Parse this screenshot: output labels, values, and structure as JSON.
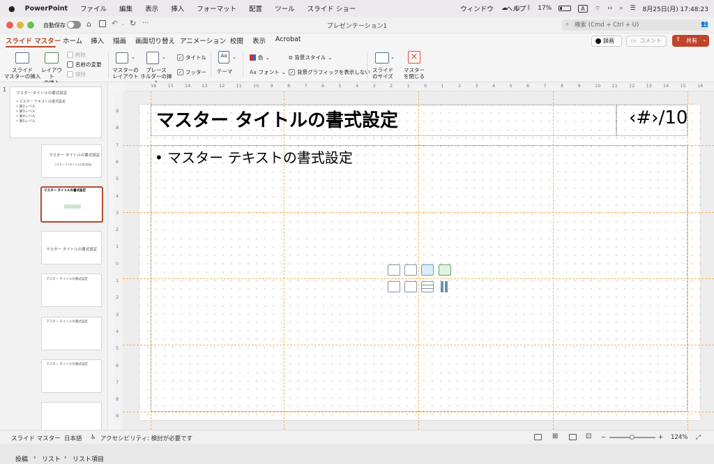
{
  "menubar": {
    "app": "PowerPoint",
    "items": [
      "ファイル",
      "編集",
      "表示",
      "挿入",
      "フォーマット",
      "配置",
      "ツール",
      "スライド ショー",
      "ウィンドウ",
      "ヘルプ"
    ],
    "battery": "17%",
    "input": "A",
    "datetime": "8月25日(月)  17:48:23"
  },
  "titlebar": {
    "autosave": "自動保存",
    "title": "プレゼンテーション1",
    "search_placeholder": "検索 (Cmd + Ctrl + U)"
  },
  "tabs": [
    "スライド マスター",
    "ホーム",
    "挿入",
    "描画",
    "画面切り替え",
    "アニメーション",
    "校閲",
    "表示",
    "Acrobat"
  ],
  "actions": {
    "record": "録画",
    "comment": "コメント",
    "share": "共有"
  },
  "ribbon": {
    "insert_master": "スライド\nマスターの挿入",
    "insert_layout": "レイアウト\nの挿入",
    "delete": "削除",
    "rename": "名前の変更",
    "preserve": "保持",
    "master_layout": "マスターの\nレイアウト",
    "insert_placeholder": "プレース\nホルダーの挿入",
    "title_check": "タイトル",
    "footer_check": "フッター",
    "theme": "テーマ",
    "colors": "色",
    "fonts": "フォント",
    "bg_styles": "背景スタイル",
    "hide_bg": "背景グラフィックを表示しない",
    "slide_size": "スライド\nのサイズ",
    "close_master": "マスター\nを閉じる"
  },
  "ruler": {
    "top": [
      "16",
      "15",
      "14",
      "13",
      "12",
      "11",
      "10",
      "9",
      "8",
      "7",
      "6",
      "5",
      "4",
      "3",
      "2",
      "1",
      "0",
      "1",
      "2",
      "3",
      "4",
      "5",
      "6",
      "7",
      "8",
      "9",
      "10",
      "11",
      "12",
      "13",
      "14",
      "15",
      "16"
    ],
    "left": [
      "9",
      "8",
      "7",
      "6",
      "5",
      "4",
      "3",
      "2",
      "1",
      "0",
      "1",
      "2",
      "3",
      "4",
      "5",
      "6",
      "7",
      "8",
      "9"
    ]
  },
  "thumbnails": {
    "number": "1",
    "master_title": "マスター タイトルの書式設定",
    "master_body": [
      "• マスター テキストの書式設定",
      "  • 第2レベル",
      "    • 第3レベル",
      "      • 第4レベル",
      "        • 第5レベル"
    ],
    "layout_title": "マスター タイトルの書式設定",
    "layout_sub": "マスター サブタイトルの書式設定"
  },
  "slide": {
    "title": "マスター タイトルの書式設定",
    "number": "‹#›/10",
    "body": "• マスター テキストの書式設定"
  },
  "status": {
    "view": "スライド マスター",
    "lang": "日本語",
    "accessibility": "アクセシビリティ: 検討が必要です",
    "zoom": "124%"
  },
  "breadcrumb": [
    "投稿",
    "リスト",
    "リスト項目"
  ]
}
